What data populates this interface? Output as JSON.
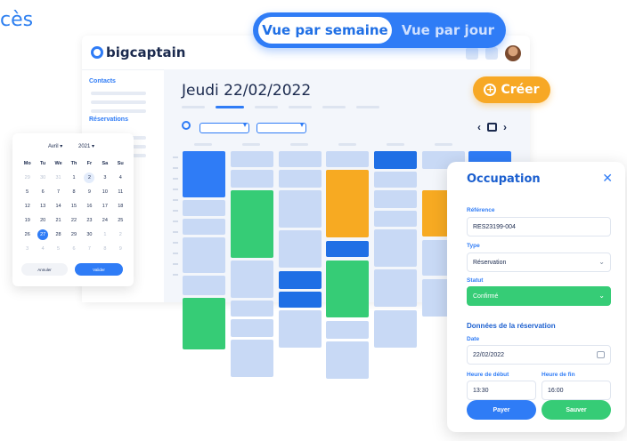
{
  "corner_text": "cès",
  "view_toggle": {
    "week_label": "Vue par semaine",
    "day_label": "Vue par jour"
  },
  "app": {
    "logo_text": "bigcaptain"
  },
  "sidebar": {
    "section_contacts": "Contacts",
    "section_reservations": "Réservations"
  },
  "main": {
    "date_title": "Jeudi 22/02/2022",
    "create_label": "Créer",
    "nav_prev": "‹",
    "nav_next": "›"
  },
  "mini_calendar": {
    "month": "Avril ▾",
    "year": "2021 ▾",
    "weekdays": [
      "Mo",
      "Tu",
      "We",
      "Th",
      "Fr",
      "Sa",
      "Su"
    ],
    "days": [
      {
        "d": "29",
        "muted": true
      },
      {
        "d": "30",
        "muted": true
      },
      {
        "d": "31",
        "muted": true
      },
      {
        "d": "1"
      },
      {
        "d": "2",
        "ring": true
      },
      {
        "d": "3"
      },
      {
        "d": "4"
      },
      {
        "d": "5"
      },
      {
        "d": "6"
      },
      {
        "d": "7"
      },
      {
        "d": "8"
      },
      {
        "d": "9"
      },
      {
        "d": "10"
      },
      {
        "d": "11"
      },
      {
        "d": "12"
      },
      {
        "d": "13"
      },
      {
        "d": "14"
      },
      {
        "d": "15"
      },
      {
        "d": "16"
      },
      {
        "d": "17"
      },
      {
        "d": "18"
      },
      {
        "d": "19"
      },
      {
        "d": "20"
      },
      {
        "d": "21"
      },
      {
        "d": "22"
      },
      {
        "d": "23"
      },
      {
        "d": "24"
      },
      {
        "d": "25"
      },
      {
        "d": "26"
      },
      {
        "d": "27",
        "today": true
      },
      {
        "d": "28"
      },
      {
        "d": "29"
      },
      {
        "d": "30"
      },
      {
        "d": "1",
        "muted": true
      },
      {
        "d": "2",
        "muted": true
      },
      {
        "d": "3",
        "muted": true
      },
      {
        "d": "4",
        "muted": true
      },
      {
        "d": "5",
        "muted": true
      },
      {
        "d": "6",
        "muted": true
      },
      {
        "d": "7",
        "muted": true
      },
      {
        "d": "8",
        "muted": true
      },
      {
        "d": "9",
        "muted": true
      }
    ],
    "cancel_label": "Annuler",
    "confirm_label": "Valider"
  },
  "panel": {
    "title": "Occupation",
    "close": "✕",
    "reference_label": "Référence",
    "reference_value": "RES23199-004",
    "type_label": "Type",
    "type_value": "Réservation",
    "status_label": "Statut",
    "status_value": "Confirmé",
    "section_title": "Données de la réservation",
    "date_label": "Date",
    "date_value": "22/02/2022",
    "start_label": "Heure de début",
    "start_value": "13:30",
    "end_label": "Heure de fin",
    "end_value": "16:00",
    "pay_label": "Payer",
    "save_label": "Sauver"
  },
  "colors": {
    "primary": "#2f7cf6",
    "green": "#36cc76",
    "orange": "#f7aa22",
    "light": "#c8d9f5"
  }
}
